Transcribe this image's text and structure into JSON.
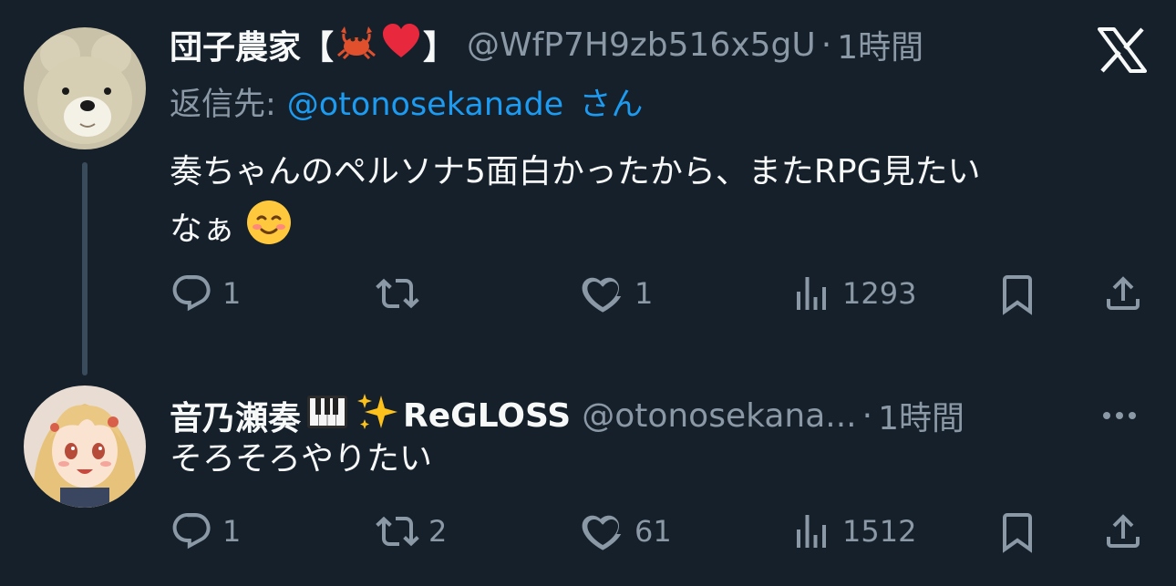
{
  "tweets": [
    {
      "display_name": "団子農家【",
      "display_name_suffix": "】",
      "emojis": [
        "crab",
        "red-heart"
      ],
      "handle": "@WfP7H9zb516x5gU",
      "separator": "·",
      "time": "1時間",
      "reply_prefix": "返信先:",
      "reply_mention": "@otonosekanade",
      "reply_suffix": "さん",
      "text_line1": "奏ちゃんのペルソナ5面白かったから、またRPG見たい",
      "text_line2": "なぁ",
      "text_emoji": "smiling-face",
      "stats": {
        "replies": "1",
        "retweets": "",
        "likes": "1",
        "views": "1293"
      }
    },
    {
      "display_name": "音乃瀬奏",
      "emojis": [
        "piano-keys",
        "sparkles"
      ],
      "affiliation": "ReGLOSS",
      "handle": "@otonosekana...",
      "separator": "·",
      "time": "1時間",
      "text_line1": "そろそろやりたい",
      "stats": {
        "replies": "1",
        "retweets": "2",
        "likes": "61",
        "views": "1512"
      }
    }
  ],
  "icons": {
    "brand": "x-logo-icon",
    "reply": "reply-icon",
    "retweet": "retweet-icon",
    "like": "heart-icon",
    "views": "views-icon",
    "bookmark": "bookmark-icon",
    "share": "share-icon",
    "more": "more-icon"
  },
  "colors": {
    "background": "#15202b",
    "text": "#f7f9f9",
    "muted": "#8b98a5",
    "link": "#1d9bf0",
    "thread_line": "#3a4b5c"
  }
}
